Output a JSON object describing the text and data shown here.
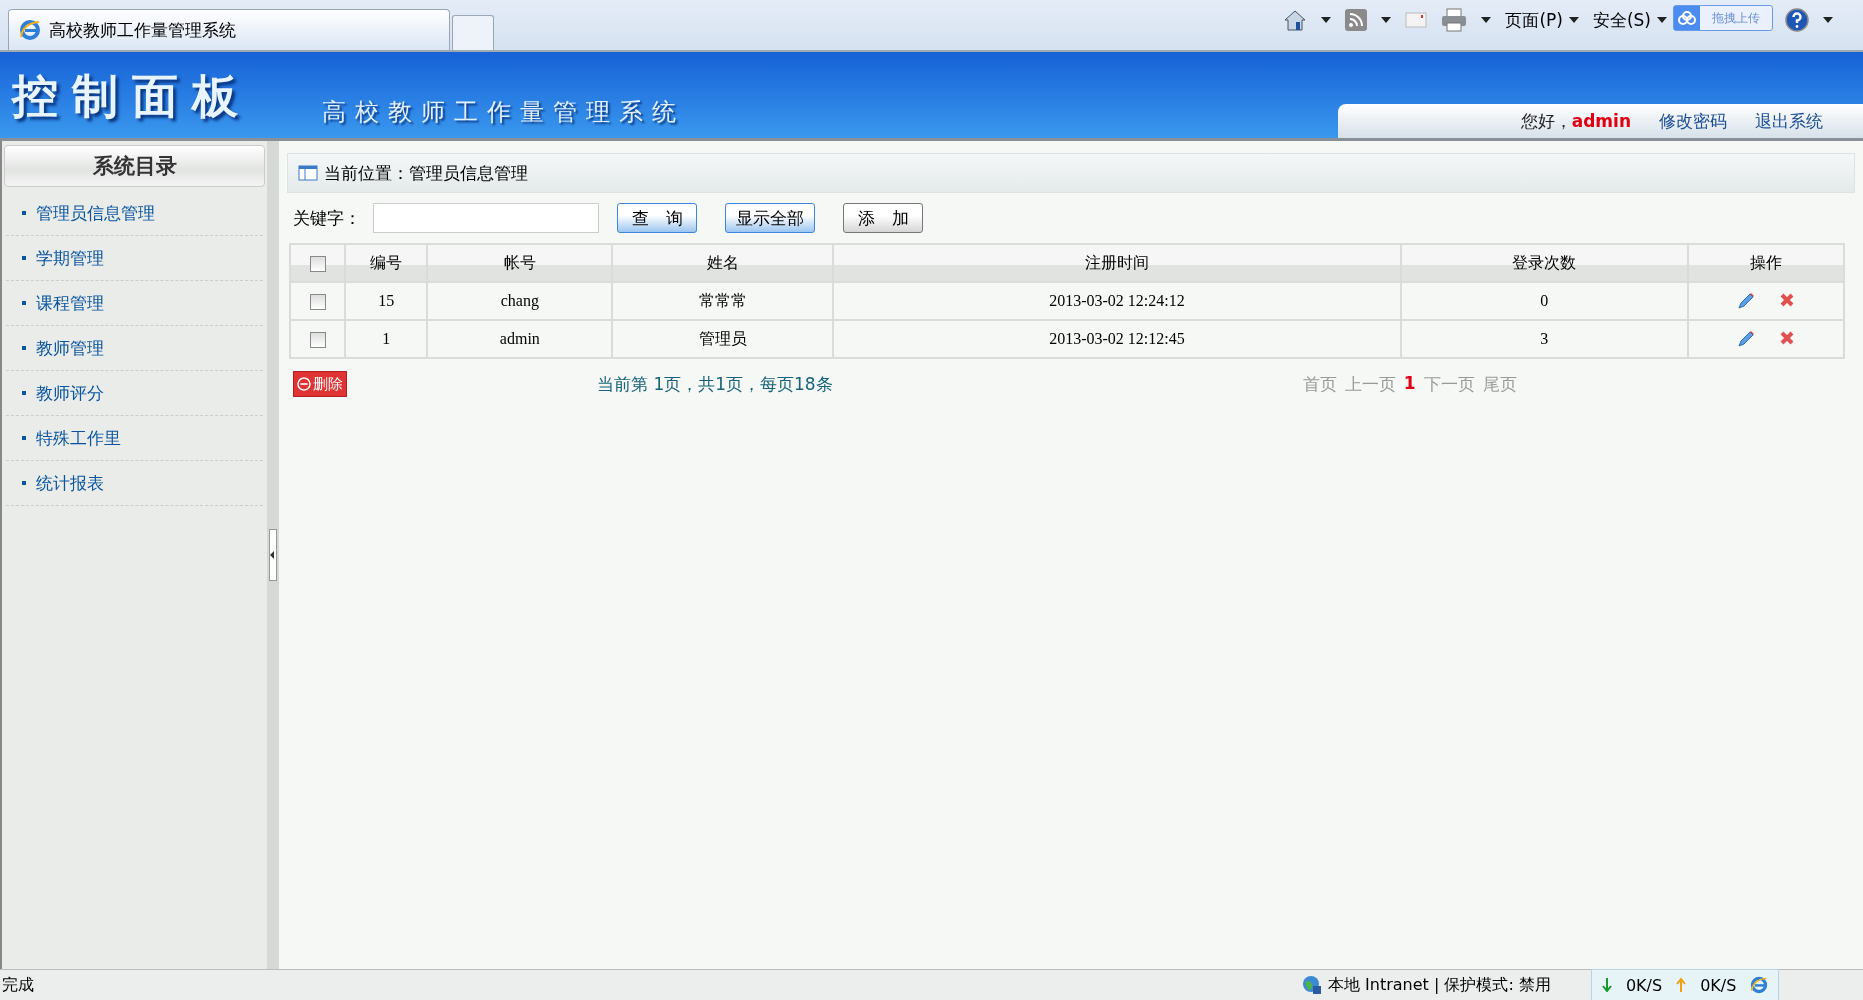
{
  "browser": {
    "tab_title": "高校教师工作量管理系统",
    "menus": [
      {
        "label": "页面(P)"
      },
      {
        "label": "安全(S)"
      }
    ],
    "upload_widget": "拖拽上传"
  },
  "header": {
    "title": "控制面板",
    "subtitle": "高校教师工作量管理系统",
    "greeting": "您好，",
    "user": "admin",
    "links": [
      "修改密码",
      "退出系统"
    ]
  },
  "sidebar": {
    "title": "系统目录",
    "items": [
      "管理员信息管理",
      "学期管理",
      "课程管理",
      "教师管理",
      "教师评分",
      "特殊工作里",
      "统计报表"
    ]
  },
  "breadcrumb": "当前位置：管理员信息管理",
  "search": {
    "label": "关键字：",
    "buttons": [
      {
        "label": "查　询",
        "kind": "primary"
      },
      {
        "label": "显示全部",
        "kind": "primary"
      },
      {
        "label": "添　加",
        "kind": "default"
      }
    ]
  },
  "table": {
    "all_checked": false,
    "columns": [
      "编号",
      "帐号",
      "姓名",
      "注册时间",
      "登录次数",
      "操作"
    ],
    "rows": [
      {
        "checked": false,
        "cells": [
          "15",
          "chang",
          "常常常",
          "2013-03-02 12:24:12",
          "0"
        ]
      },
      {
        "checked": false,
        "cells": [
          "1",
          "admin",
          "管理员",
          "2013-03-02 12:12:45",
          "3"
        ]
      }
    ]
  },
  "delete_button": "删除",
  "pagination_info": "当前第 1页，共1页，每页18条",
  "pager": [
    {
      "label": "首页",
      "selected": false
    },
    {
      "label": "上一页",
      "selected": false
    },
    {
      "label": "1",
      "selected": true
    },
    {
      "label": "下一页",
      "selected": false
    },
    {
      "label": "尾页",
      "selected": false
    }
  ],
  "status_bar": {
    "text": "完成",
    "zone": "本地 Intranet | 保护模式: 禁用",
    "down": "0K/S",
    "up": "0K/S"
  }
}
